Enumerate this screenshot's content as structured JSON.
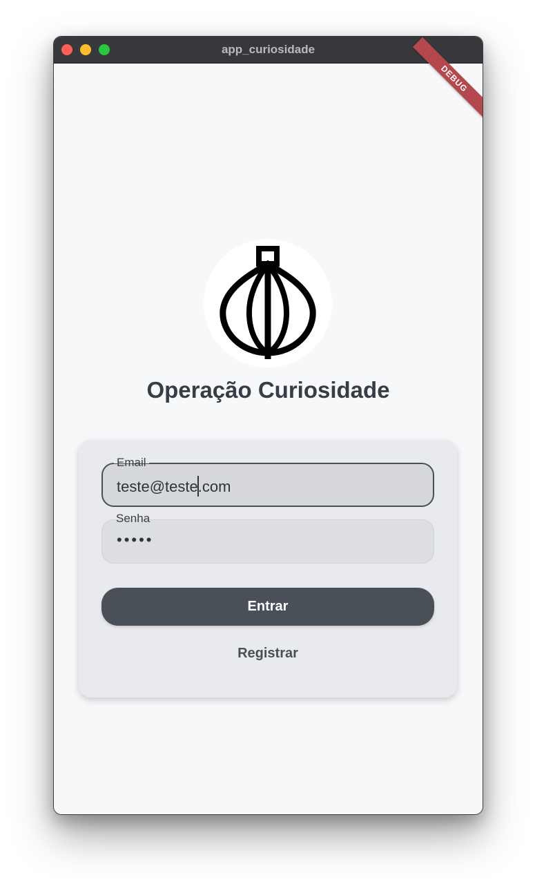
{
  "window": {
    "title": "app_curiosidade",
    "debug_banner": "DEBUG"
  },
  "logo": {
    "icon": "onion-icon"
  },
  "main": {
    "title": "Operação Curiosidade"
  },
  "form": {
    "email": {
      "label": "Email",
      "value_before_caret": "teste@teste",
      "value_after_caret": ".com"
    },
    "password": {
      "label": "Senha",
      "masked_value": "•••••"
    },
    "submit_label": "Entrar",
    "register_label": "Registrar"
  },
  "colors": {
    "background": "#f7f8fa",
    "card": "#e8eaed",
    "primary_button": "#4a5058",
    "title_text": "#383c45",
    "debug_banner": "#b5484f"
  }
}
